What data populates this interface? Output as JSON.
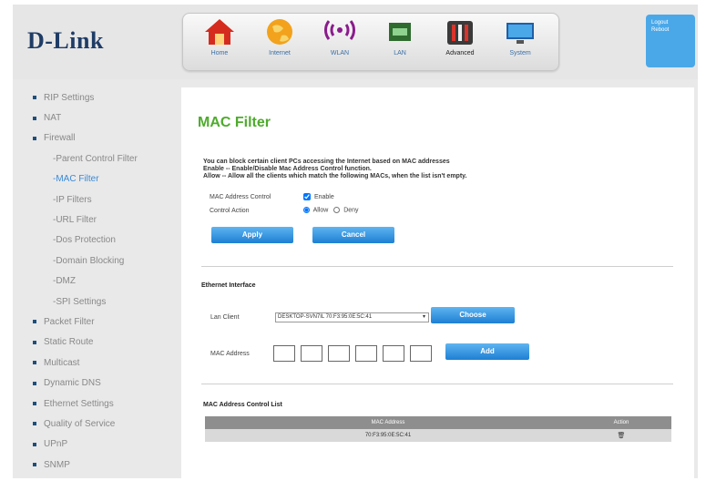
{
  "brand": {
    "logo": "D-Link"
  },
  "nav": {
    "items": [
      {
        "label": "Home"
      },
      {
        "label": "Internet"
      },
      {
        "label": "WLAN"
      },
      {
        "label": "LAN"
      },
      {
        "label": "Advanced"
      },
      {
        "label": "System"
      }
    ],
    "active": "Advanced"
  },
  "account": {
    "logout": "Logout",
    "reboot": "Reboot"
  },
  "sidebar": {
    "items": [
      {
        "label": "RIP Settings",
        "sub": false
      },
      {
        "label": "NAT",
        "sub": false
      },
      {
        "label": "Firewall",
        "sub": false
      },
      {
        "label": "-Parent Control Filter",
        "sub": true
      },
      {
        "label": "-MAC Filter",
        "sub": true,
        "active": true
      },
      {
        "label": "-IP Filters",
        "sub": true
      },
      {
        "label": "-URL Filter",
        "sub": true
      },
      {
        "label": "-Dos Protection",
        "sub": true
      },
      {
        "label": "-Domain Blocking",
        "sub": true
      },
      {
        "label": "-DMZ",
        "sub": true
      },
      {
        "label": "-SPI Settings",
        "sub": true
      },
      {
        "label": "Packet Filter",
        "sub": false
      },
      {
        "label": "Static Route",
        "sub": false
      },
      {
        "label": "Multicast",
        "sub": false
      },
      {
        "label": "Dynamic DNS",
        "sub": false
      },
      {
        "label": "Ethernet Settings",
        "sub": false
      },
      {
        "label": "Quality of Service",
        "sub": false
      },
      {
        "label": "UPnP",
        "sub": false
      },
      {
        "label": "SNMP",
        "sub": false
      }
    ]
  },
  "main": {
    "title": "MAC Filter",
    "desc1": "You can block certain client PCs accessing the Internet based on MAC addresses",
    "desc2": "Enable -- Enable/Disable Mac Address Control function.",
    "desc3": "Allow -- Allow all the clients which match the following MACs, when the list isn't empty.",
    "control_label": "MAC Address Control",
    "enable_label": "Enable",
    "action_label": "Control Action",
    "allow_label": "Allow",
    "deny_label": "Deny",
    "apply": "Apply",
    "cancel": "Cancel",
    "eth_title": "Ethernet Interface",
    "lan_label": "Lan Client",
    "lan_value": "DESKTOP-SVN7IL 70:F3:95:0E:5C:41",
    "choose": "Choose",
    "mac_label": "MAC Address",
    "add": "Add",
    "list_title": "MAC Address Control List",
    "col_mac": "MAC Address",
    "col_action": "Action",
    "row_mac": "70:F3:95:0E:5C:41"
  },
  "colors": {
    "accent": "#4eab2c",
    "button": "#1d7fd3",
    "logo": "#1f3c66"
  }
}
